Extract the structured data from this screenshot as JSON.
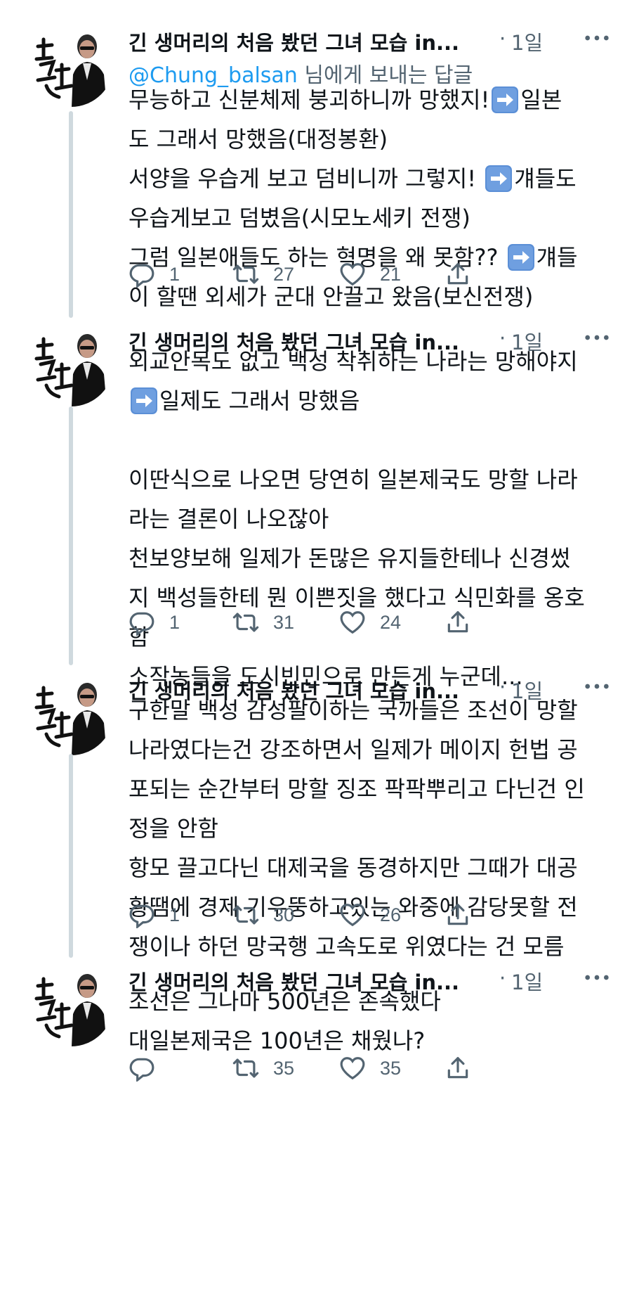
{
  "author": {
    "name": "긴 생머리의 처음 봤던 그녀 모습 in...",
    "time": "1일"
  },
  "separator": "·",
  "reply_prefix": "@Chung_balsan",
  "reply_suffix": " 님에게 보내는 답글",
  "icons": {
    "arrow_emoji": "arrow-right-icon",
    "reply": "reply-icon",
    "retweet": "retweet-icon",
    "like": "heart-icon",
    "share": "share-icon",
    "more": "more-icon"
  },
  "colors": {
    "secondary": "#536471",
    "link": "#1d9bf0",
    "thread_line": "#cfd9de",
    "emoji_blue": "#5b8fd6"
  },
  "tweets": [
    {
      "lines": [
        [
          {
            "t": "무능하고 신분체제 붕괴하니까 망했지!"
          },
          {
            "icon": "arrow"
          },
          {
            "t": "일본"
          }
        ],
        [
          {
            "t": "도 그래서 망했음(대정봉환)"
          }
        ],
        [
          {
            "t": "서양을 우습게 보고 덤비니까 그렇지! "
          },
          {
            "icon": "arrow"
          },
          {
            "t": "걔들도"
          }
        ],
        [
          {
            "t": "우습게보고 덤볐음(시모노세키 전쟁)"
          }
        ],
        [
          {
            "t": "그럼 일본애들도 하는 혁명을 왜 못함?? "
          },
          {
            "icon": "arrow"
          },
          {
            "t": "걔들"
          }
        ],
        [
          {
            "t": "이 할땐 외세가 군대 안끌고 왔음(보신전쟁)"
          }
        ]
      ],
      "replies": "1",
      "retweets": "27",
      "likes": "21"
    },
    {
      "lines": [
        [
          {
            "t": "외교안목도 없고 백성 착취하는 나라는 망해야지"
          }
        ],
        [
          {
            "icon": "arrow"
          },
          {
            "t": "일제도 그래서 망했음"
          }
        ],
        [],
        [
          {
            "t": "이딴식으로 나오면 당연히 일본제국도 망할 나라"
          }
        ],
        [
          {
            "t": "라는 결론이 나오잖아"
          }
        ],
        [
          {
            "t": "천보양보해 일제가 돈많은 유지들한테나 신경썼"
          }
        ],
        [
          {
            "t": "지 백성들한테 뭔 이쁜짓을 했다고 식민화를 옹호"
          }
        ],
        [
          {
            "t": "함"
          }
        ],
        [
          {
            "t": "소작농들을 도시빈민으로 만든게 누군데..."
          }
        ]
      ],
      "replies": "1",
      "retweets": "31",
      "likes": "24"
    },
    {
      "lines": [
        [
          {
            "t": "구한말 백성 감성팔이하는 국까들은 조선이 망할"
          }
        ],
        [
          {
            "t": "나라였다는건 강조하면서 일제가 메이지 헌법 공"
          }
        ],
        [
          {
            "t": "포되는 순간부터 망할 징조 팍팍뿌리고 다닌건 인"
          }
        ],
        [
          {
            "t": "정을 안함"
          }
        ],
        [
          {
            "t": "항모 끌고다닌 대제국을 동경하지만 그때가 대공"
          }
        ],
        [
          {
            "t": "황땜에 경제 기우뚱하고있는 와중에 감당못할 전"
          }
        ],
        [
          {
            "t": "쟁이나 하던 망국행 고속도로 위였다는 건 모름"
          }
        ]
      ],
      "replies": "1",
      "retweets": "30",
      "likes": "26"
    },
    {
      "lines": [
        [
          {
            "t": "조선은 그나마 500년은 존속했다"
          }
        ],
        [
          {
            "t": "대일본제국은 100년은 채웠나?"
          }
        ]
      ],
      "replies": "",
      "retweets": "35",
      "likes": "35"
    }
  ]
}
